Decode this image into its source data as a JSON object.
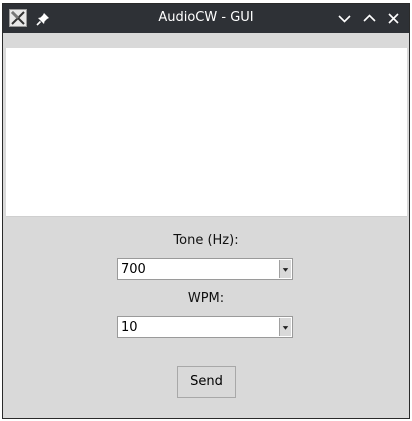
{
  "window": {
    "title": "AudioCW - GUI"
  },
  "titlebar": {
    "app_icon": "x-app-icon",
    "pin_icon": "pin-icon",
    "controls": [
      "chevron-down-icon",
      "chevron-up-icon",
      "close-icon"
    ]
  },
  "form": {
    "tone_label": "Tone (Hz):",
    "tone_value": "700",
    "wpm_label": "WPM:",
    "wpm_value": "10",
    "send_label": "Send"
  },
  "colors": {
    "titlebar": "#2e3136",
    "window_bg": "#d9d9d9",
    "text_area_bg": "#ffffff"
  }
}
